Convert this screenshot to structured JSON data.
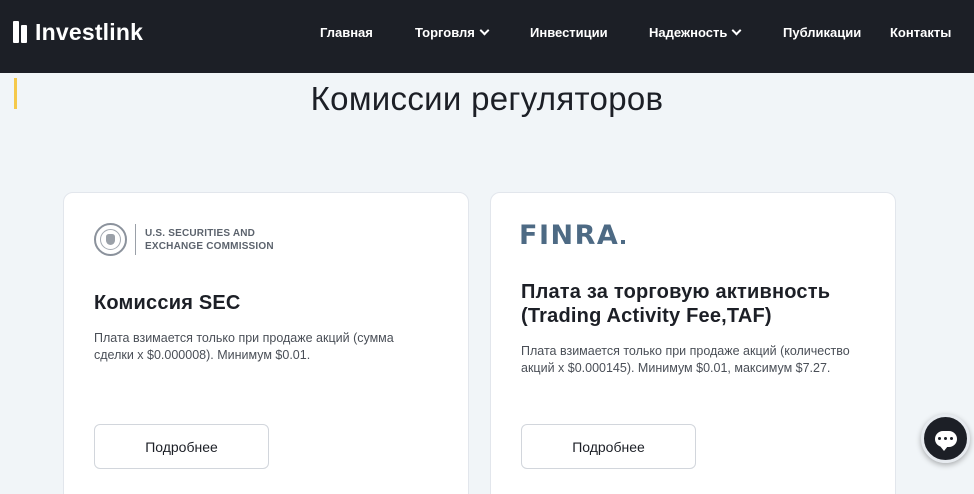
{
  "header": {
    "logo_text": "Investlink",
    "nav": [
      {
        "label": "Главная",
        "has_dropdown": false
      },
      {
        "label": "Торговля",
        "has_dropdown": true
      },
      {
        "label": "Инвестиции",
        "has_dropdown": false
      },
      {
        "label": "Надежность",
        "has_dropdown": true
      },
      {
        "label": "Публикации",
        "has_dropdown": false
      },
      {
        "label": "Контакты",
        "has_dropdown": false
      }
    ]
  },
  "main": {
    "title": "Комиссии регуляторов",
    "cards": [
      {
        "logo_line1": "U.S. SECURITIES AND",
        "logo_line2": "EXCHANGE COMMISSION",
        "title": "Комиссия SEC",
        "description": "Плата взимается только при продаже акций (сумма сделки x $0.000008). Минимум $0.01.",
        "button_label": "Подробнее"
      },
      {
        "logo_text": "FINRA",
        "title": "Плата за торговую активность (Trading Activity Fee,TAF)",
        "description": "Плата взимается только при продаже акций (количество акций x $0.000145). Минимум $0.01, максимум $7.27.",
        "button_label": "Подробнее"
      }
    ]
  },
  "icons": {
    "chat": "chat-bubble-icon",
    "sec_logo": "sec-seal-icon",
    "dropdown": "chevron-down-icon"
  },
  "colors": {
    "header_bg": "#1c1f26",
    "page_bg": "#f1f5f8",
    "accent": "#f5c94b",
    "finra_blue": "#4d6a84"
  }
}
